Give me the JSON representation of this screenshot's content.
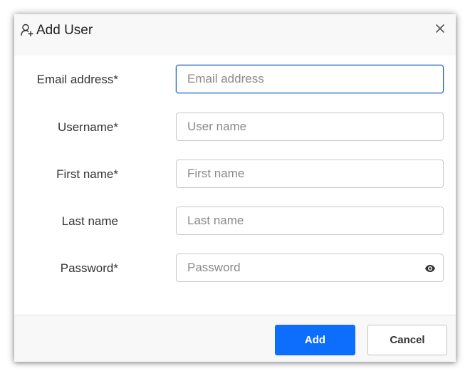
{
  "dialog": {
    "title": "Add User",
    "title_icon": "user-add-icon",
    "close_icon": "close-icon"
  },
  "form": {
    "fields": [
      {
        "label": "Email address*",
        "placeholder": "Email address",
        "value": "",
        "focused": true
      },
      {
        "label": "Username*",
        "placeholder": "User name",
        "value": ""
      },
      {
        "label": "First name*",
        "placeholder": "First name",
        "value": ""
      },
      {
        "label": "Last name",
        "placeholder": "Last name",
        "value": ""
      },
      {
        "label": "Password*",
        "placeholder": "Password",
        "value": "",
        "icon": "eye-icon"
      }
    ]
  },
  "footer": {
    "add_label": "Add",
    "cancel_label": "Cancel"
  },
  "colors": {
    "primary": "#0d6efd",
    "focus_border": "#1565c0"
  }
}
